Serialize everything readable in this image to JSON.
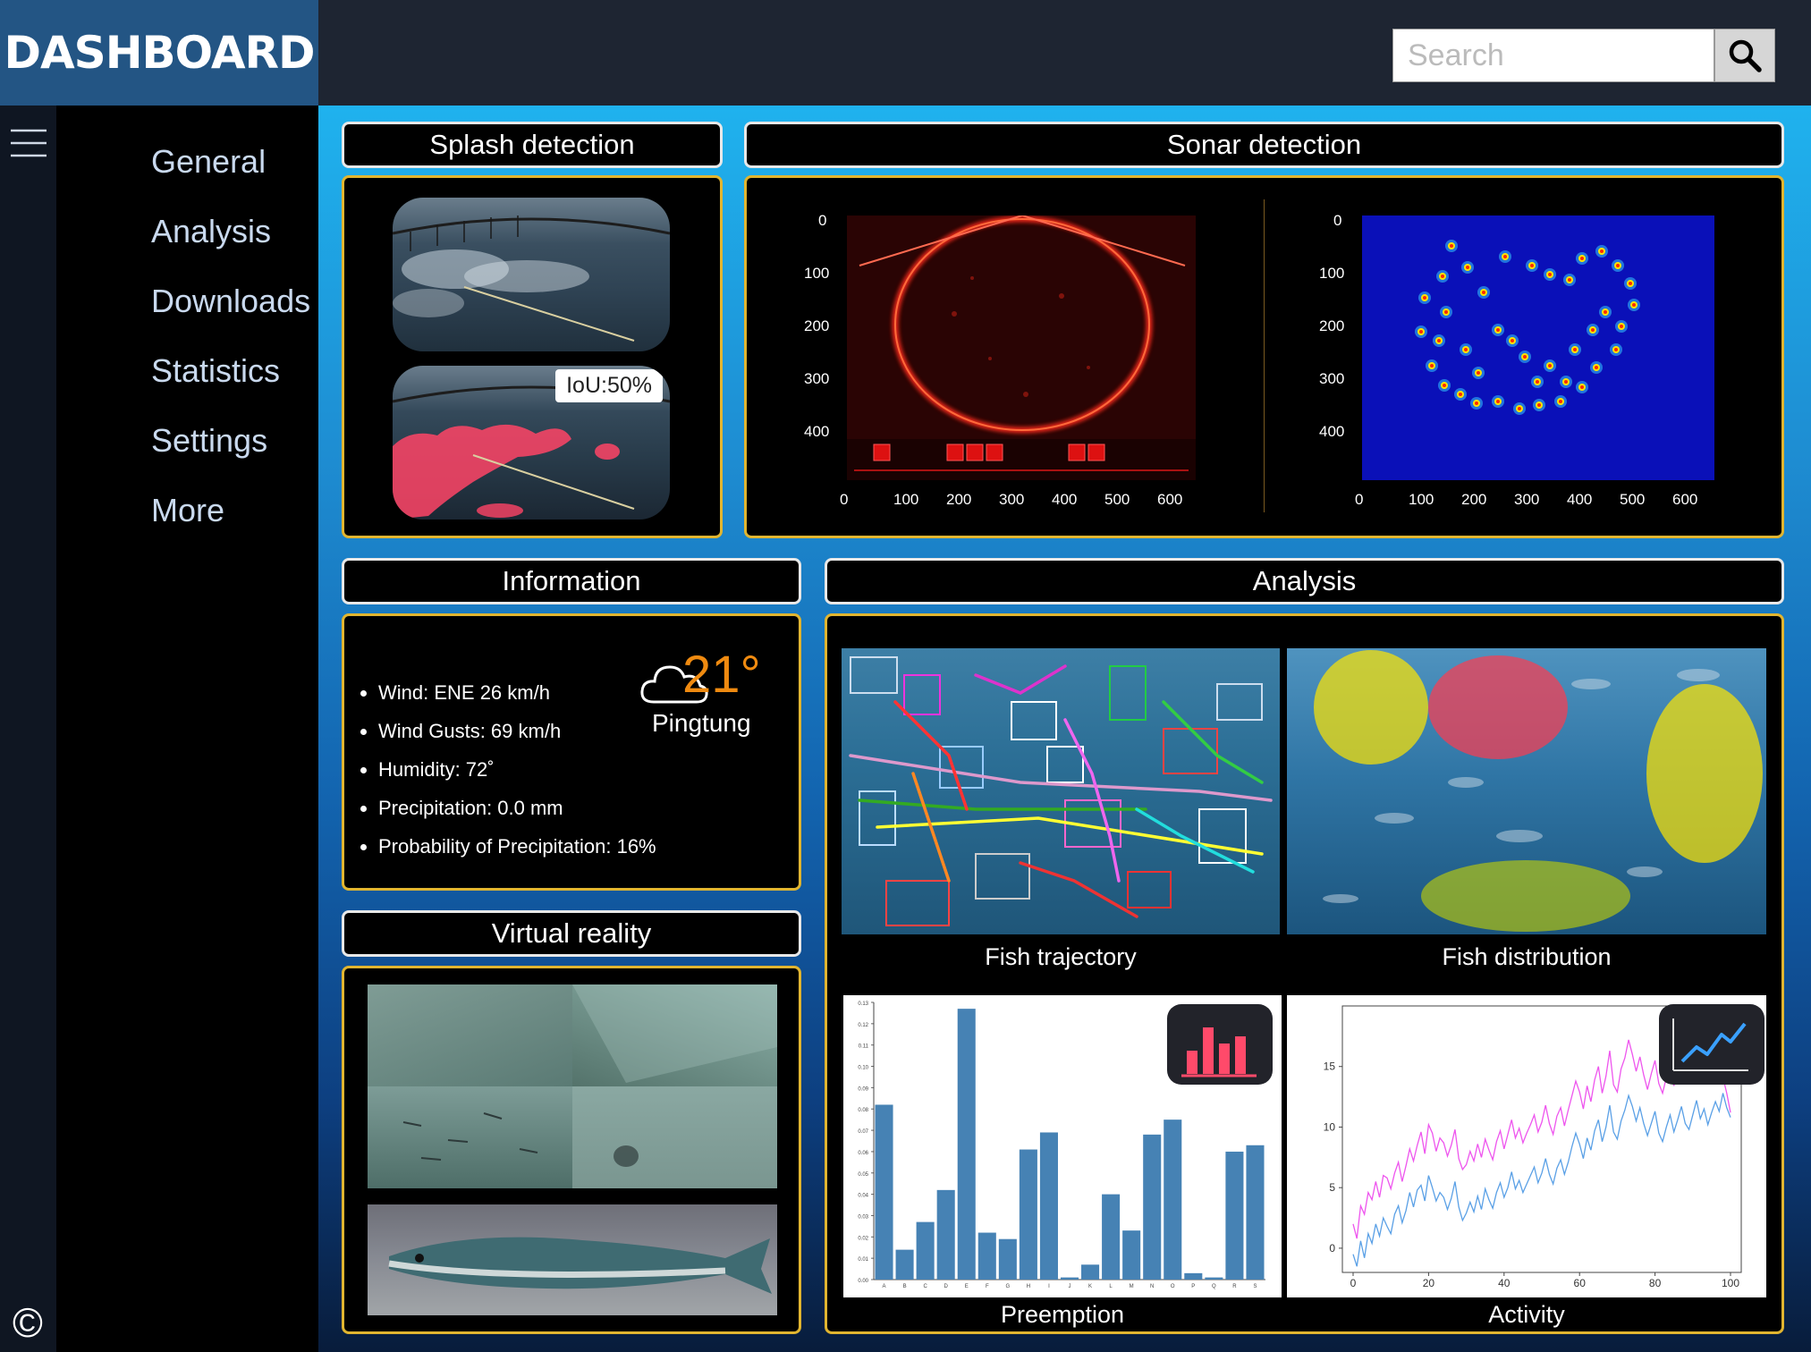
{
  "app": {
    "title": "DASHBOARD"
  },
  "search": {
    "placeholder": "Search"
  },
  "sidebar": {
    "items": [
      {
        "label": "General"
      },
      {
        "label": "Analysis"
      },
      {
        "label": "Downloads"
      },
      {
        "label": "Statistics"
      },
      {
        "label": "Settings"
      },
      {
        "label": "More"
      }
    ]
  },
  "footer": {
    "copyright": "©"
  },
  "sections": {
    "splash": {
      "title": "Splash detection",
      "iou_badge": "IoU:50%"
    },
    "sonar": {
      "title": "Sonar detection"
    },
    "information": {
      "title": "Information"
    },
    "analysis": {
      "title": "Analysis"
    },
    "vr": {
      "title": "Virtual reality"
    }
  },
  "sonar_axes": {
    "y_ticks": [
      "0",
      "100",
      "200",
      "300",
      "400"
    ],
    "x_ticks": [
      "0",
      "100",
      "200",
      "300",
      "400",
      "500",
      "600"
    ]
  },
  "weather": {
    "temperature": "21°",
    "location": "Pingtung",
    "icon": "cloud-icon",
    "details": [
      "Wind: ENE 26 km/h",
      "Wind Gusts: 69 km/h",
      "Humidity: 72˚",
      "Precipitation: 0.0 mm",
      "Probability of Precipitation: 16%"
    ]
  },
  "analysis_tiles": {
    "trajectory": "Fish trajectory",
    "distribution": "Fish distribution",
    "preemption": "Preemption",
    "activity": "Activity"
  },
  "colors": {
    "accent": "#e1b530",
    "logo_bg": "#235584",
    "bar": "#4682b4",
    "series_pink": "#ee55ee",
    "series_blue": "#5aa0e6"
  },
  "chart_data": [
    {
      "type": "bar",
      "categories": [
        "A",
        "B",
        "C",
        "D",
        "E",
        "F",
        "G",
        "H",
        "I",
        "J",
        "K",
        "L",
        "M",
        "N",
        "O",
        "P",
        "Q",
        "R",
        "S"
      ],
      "values": [
        0.082,
        0.014,
        0.027,
        0.042,
        0.127,
        0.022,
        0.019,
        0.061,
        0.069,
        0.001,
        0.007,
        0.04,
        0.023,
        0.068,
        0.075,
        0.003,
        0.001,
        0.06,
        0.063
      ],
      "y_ticks": [
        "0.00",
        "0.01",
        "0.02",
        "0.03",
        "0.04",
        "0.05",
        "0.06",
        "0.07",
        "0.08",
        "0.09",
        "0.10",
        "0.11",
        "0.12",
        "0.13"
      ],
      "ylim": [
        0,
        0.13
      ],
      "title": "",
      "xlabel": "",
      "ylabel": ""
    },
    {
      "type": "line",
      "x_ticks": [
        "0",
        "20",
        "40",
        "60",
        "80",
        "100"
      ],
      "y_ticks": [
        "0",
        "5",
        "10",
        "15"
      ],
      "xlim": [
        0,
        100
      ],
      "ylim": [
        -2,
        20
      ],
      "series": [
        {
          "color": "#ee55ee",
          "values": [
            2,
            0.8,
            3.5,
            2.8,
            4.6,
            4.0,
            5.5,
            4.2,
            6.0,
            5.8,
            4.9,
            6.2,
            7.1,
            5.5,
            6.8,
            8.2,
            7.2,
            8.5,
            9.6,
            7.8,
            10.2,
            9.5,
            8.0,
            9.1,
            8.7,
            7.6,
            8.5,
            9.8,
            7.4,
            6.5,
            6.9,
            8.0,
            7.2,
            8.6,
            7.5,
            9.0,
            8.1,
            7.3,
            8.8,
            9.7,
            8.2,
            9.4,
            10.6,
            9.1,
            9.9,
            8.7,
            9.5,
            10.2,
            11.0,
            9.6,
            10.4,
            11.8,
            10.3,
            9.4,
            10.9,
            11.6,
            10.1,
            11.4,
            12.6,
            13.8,
            12.9,
            11.5,
            13.4,
            12.1,
            13.9,
            15.0,
            12.8,
            14.2,
            16.3,
            13.5,
            12.9,
            14.8,
            15.7,
            17.2,
            16.0,
            14.6,
            15.8,
            14.3,
            13.1,
            14.4,
            15.5,
            13.6,
            12.8,
            14.1,
            15.2,
            13.4,
            14.8,
            15.9,
            14.2,
            13.8,
            15.1,
            16.4,
            14.7,
            15.6,
            13.9,
            15.3,
            16.2,
            15.0,
            14.1,
            12.8,
            11.2
          ]
        },
        {
          "color": "#5aa0e6",
          "values": [
            -0.5,
            -1.5,
            0.6,
            -0.8,
            1.2,
            0.4,
            2.0,
            1.0,
            2.5,
            1.8,
            1.2,
            2.8,
            3.5,
            2.1,
            3.1,
            4.6,
            3.4,
            4.8,
            5.2,
            3.9,
            6.0,
            5.0,
            3.9,
            4.6,
            4.2,
            3.2,
            4.1,
            5.5,
            3.4,
            2.3,
            2.9,
            3.8,
            3.0,
            4.3,
            3.2,
            4.9,
            4.0,
            3.3,
            4.6,
            5.4,
            4.2,
            5.0,
            6.3,
            4.9,
            5.6,
            4.6,
            5.3,
            6.0,
            6.7,
            5.4,
            6.2,
            7.4,
            6.1,
            5.3,
            6.6,
            7.3,
            6.1,
            7.1,
            8.4,
            9.5,
            8.6,
            7.4,
            9.1,
            8.1,
            9.7,
            10.6,
            8.8,
            10.0,
            11.8,
            9.6,
            9.0,
            10.5,
            11.4,
            12.6,
            11.7,
            10.5,
            11.6,
            10.3,
            9.3,
            10.3,
            11.3,
            9.5,
            8.8,
            10.0,
            11.0,
            9.6,
            10.6,
            11.7,
            10.3,
            9.8,
            11.0,
            12.2,
            10.7,
            11.5,
            10.2,
            11.2,
            12.1,
            11.3,
            12.8,
            11.6,
            10.8
          ]
        }
      ],
      "title": "",
      "xlabel": "",
      "ylabel": ""
    }
  ]
}
